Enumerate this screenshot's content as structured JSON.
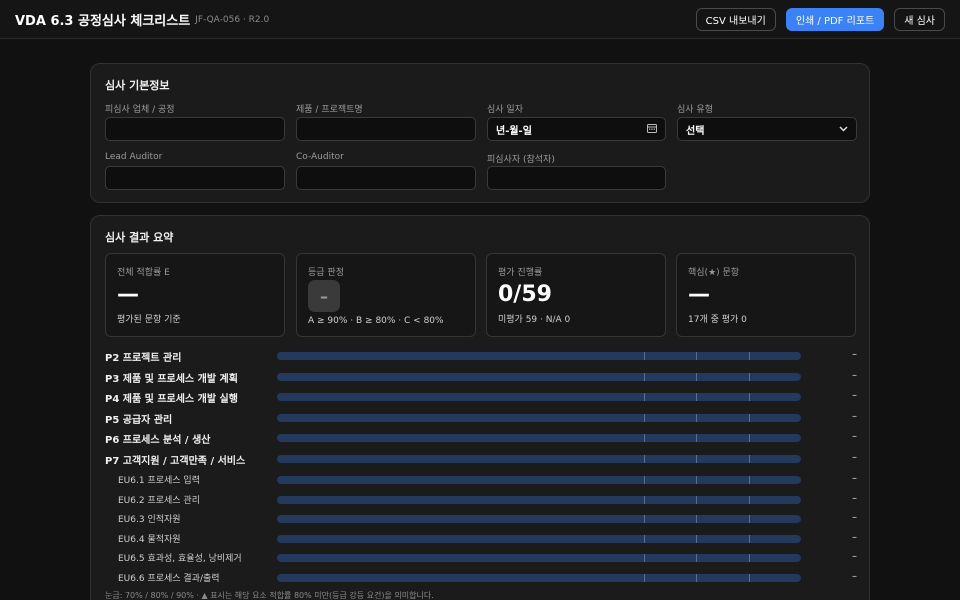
{
  "header": {
    "title": "VDA 6.3 공정심사 체크리스트",
    "doc_code": "JF-QA-056 · R2.0",
    "buttons": {
      "csv_export": "CSV 내보내기",
      "print_pdf": "인쇄 / PDF 리포트",
      "new_audit": "새 심사"
    }
  },
  "colors": {
    "accent": "#3b82f6",
    "background": "#111111",
    "card": "#1b1b1b",
    "track": "#233a5e"
  },
  "basic_info": {
    "title": "심사 기본정보",
    "fields": {
      "auditee": {
        "label": "피심사 업체 / 공정",
        "value": ""
      },
      "product": {
        "label": "제품 / 프로젝트명",
        "value": ""
      },
      "date": {
        "label": "심사 일자",
        "value": "년-월-일",
        "icon": "calendar-icon"
      },
      "type": {
        "label": "심사 유형",
        "value": "선택",
        "icon": "chevron-down-icon"
      },
      "lead_auditor": {
        "label": "Lead Auditor",
        "value": ""
      },
      "co_auditor": {
        "label": "Co-Auditor",
        "value": ""
      },
      "attendee": {
        "label": "피심사자 (참석자)",
        "value": ""
      }
    }
  },
  "summary": {
    "title": "심사 결과 요약",
    "stats": {
      "compliance": {
        "label": "전체 적합률 E",
        "value": "—",
        "note": "평가된 문항 기준"
      },
      "grade": {
        "label": "등급 판정",
        "value": "–",
        "note": "A ≥ 90% · B ≥ 80% · C < 80%"
      },
      "progress": {
        "label": "평가 진행률",
        "value": "0/59",
        "note": "미평가 59 · N/A 0"
      },
      "key_items": {
        "label": "핵심(★) 문항",
        "value": "—",
        "note": "17개 중 평가 0"
      }
    },
    "rows": [
      {
        "label": "P2 프로젝트 관리",
        "value": "–",
        "level": "main",
        "fill": 0
      },
      {
        "label": "P3 제품 및 프로세스 개발 계획",
        "value": "–",
        "level": "main",
        "fill": 0
      },
      {
        "label": "P4 제품 및 프로세스 개발 실행",
        "value": "–",
        "level": "main",
        "fill": 0
      },
      {
        "label": "P5 공급자 관리",
        "value": "–",
        "level": "main",
        "fill": 0
      },
      {
        "label": "P6 프로세스 분석 / 생산",
        "value": "–",
        "level": "main",
        "fill": 0
      },
      {
        "label": "P7 고객지원 / 고객만족 / 서비스",
        "value": "–",
        "level": "main",
        "fill": 0
      },
      {
        "label": "EU6.1 프로세스 입력",
        "value": "–",
        "level": "sub",
        "fill": 0
      },
      {
        "label": "EU6.2 프로세스 관리",
        "value": "–",
        "level": "sub",
        "fill": 0
      },
      {
        "label": "EU6.3 인적자원",
        "value": "–",
        "level": "sub",
        "fill": 0
      },
      {
        "label": "EU6.4 물적자원",
        "value": "–",
        "level": "sub",
        "fill": 0
      },
      {
        "label": "EU6.5 효과성, 효율성, 낭비제거",
        "value": "–",
        "level": "sub",
        "fill": 0
      },
      {
        "label": "EU6.6 프로세스 결과/출력",
        "value": "–",
        "level": "sub",
        "fill": 0
      }
    ],
    "threshold_marks": [
      70,
      80,
      90
    ],
    "legend": "눈금: 70% / 80% / 90% · ▲ 표시는 해당 요소 적합률 80% 미만(등급 강등 요건)을 의미합니다."
  }
}
